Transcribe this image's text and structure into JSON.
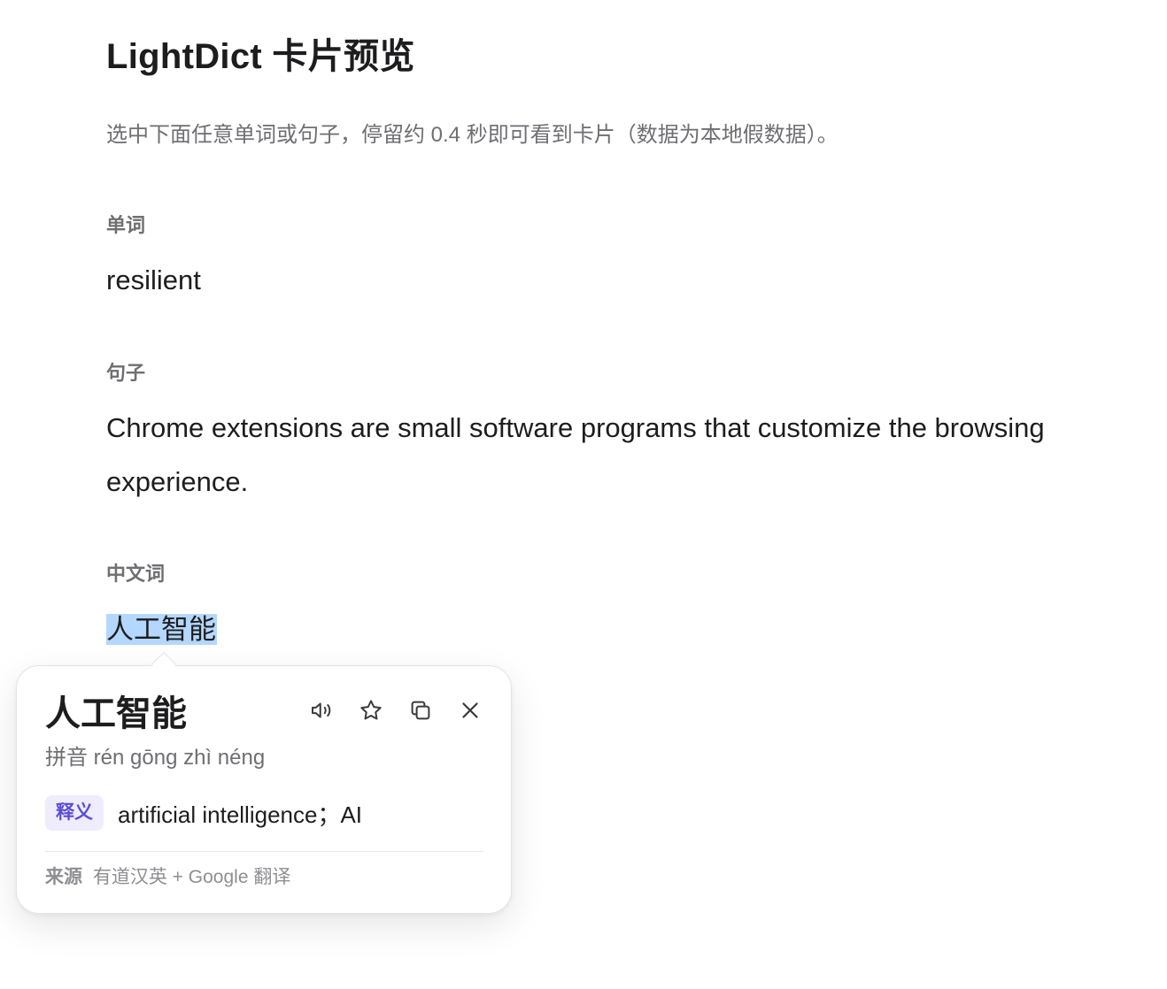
{
  "page": {
    "title": "LightDict 卡片预览",
    "subtitle": "选中下面任意单词或句子，停留约 0.4 秒即可看到卡片（数据为本地假数据）。"
  },
  "sections": {
    "word": {
      "label": "单词",
      "text": "resilient"
    },
    "sentence": {
      "label": "句子",
      "text": "Chrome extensions are small software programs that customize the browsing experience."
    },
    "chinese": {
      "label": "中文词",
      "text": "人工智能"
    }
  },
  "card": {
    "word": "人工智能",
    "pinyin_label": "拼音",
    "pinyin": "rén gōng zhì néng",
    "meaning_tag": "释义",
    "meaning": "artificial intelligence；AI",
    "source_label": "来源",
    "source": "有道汉英 + Google 翻译",
    "actions": [
      "speaker-icon",
      "star-icon",
      "copy-icon",
      "close-icon"
    ]
  },
  "colors": {
    "selection": "#b4d7ff",
    "tag_bg": "#eeecfd",
    "tag_text": "#5a4dd6",
    "muted": "#6e6e73"
  }
}
